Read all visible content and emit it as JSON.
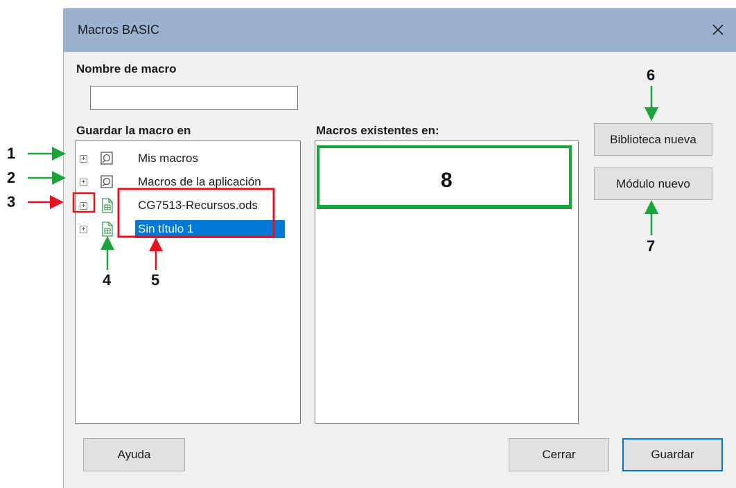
{
  "dialog": {
    "title": "Macros BASIC",
    "macro_name_label": "Nombre de macro",
    "macro_name_value": "",
    "save_in_label": "Guardar la macro en",
    "existing_label": "Macros existentes en:"
  },
  "tree": {
    "items": [
      {
        "label": "Mis macros",
        "icon": "macro-library-icon",
        "selected": false
      },
      {
        "label": "Macros de la aplicación",
        "icon": "macro-library-icon",
        "selected": false
      },
      {
        "label": "CG7513-Recursos.ods",
        "icon": "spreadsheet-document-icon",
        "selected": false
      },
      {
        "label": "Sin título 1",
        "icon": "spreadsheet-document-icon",
        "selected": true
      }
    ]
  },
  "buttons": {
    "new_library": "Biblioteca nueva",
    "new_module": "Módulo nuevo",
    "help": "Ayuda",
    "close": "Cerrar",
    "save": "Guardar"
  },
  "callouts": [
    "1",
    "2",
    "3",
    "4",
    "5",
    "6",
    "7",
    "8"
  ],
  "colors": {
    "titlebar": "#9ab2cd",
    "selection": "#0078d7",
    "callout_green": "#1aa53a",
    "callout_red": "#e8121e"
  }
}
